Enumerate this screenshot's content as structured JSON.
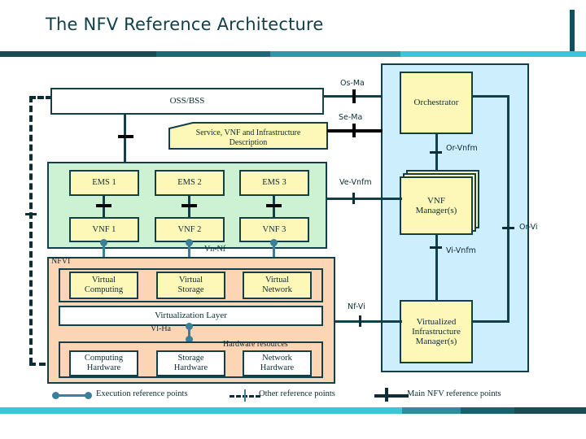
{
  "slide": {
    "title": "The NFV Reference Architecture"
  },
  "theme": {
    "accent_dark": "#14505c",
    "accent_mid": "#1f6676",
    "accent_light": "#2e97a8",
    "accent_bright": "#3bc6d4",
    "box_border": "#123f48",
    "yellow_fill": "#fdf8b8",
    "green_panel": "#ccf2d3",
    "orange_panel": "#fbd5b4",
    "blue_panel": "#cdeefc",
    "exec_point": "#3c7f99"
  },
  "oss": {
    "label": "OSS/BSS"
  },
  "description_note": {
    "line1": "Service, VNF and Infrastructure",
    "line2": "Description"
  },
  "vnf_domain": {
    "ems": [
      "EMS 1",
      "EMS 2",
      "EMS 3"
    ],
    "vnf": [
      "VNF 1",
      "VNF 2",
      "VNF 3"
    ]
  },
  "nfvi": {
    "label": "NFVI",
    "virtual_resources": [
      {
        "line1": "Virtual",
        "line2": "Computing"
      },
      {
        "line1": "Virtual",
        "line2": "Storage"
      },
      {
        "line1": "Virtual",
        "line2": "Network"
      }
    ],
    "virtualization_layer": "Virtualization Layer",
    "hardware_group_label": "Hardware resources",
    "hardware": [
      {
        "line1": "Computing",
        "line2": "Hardware"
      },
      {
        "line1": "Storage",
        "line2": "Hardware"
      },
      {
        "line1": "Network",
        "line2": "Hardware"
      }
    ]
  },
  "mano": {
    "orchestrator": "Orchestrator",
    "vnf_manager": {
      "line1": "VNF",
      "line2": "Manager(s)"
    },
    "vim": {
      "line1": "Virtualized",
      "line2": "Infrastructure",
      "line3": "Manager(s)"
    }
  },
  "reference_points": {
    "os_ma": "Os-Ma",
    "se_ma": "Se-Ma",
    "ve_vnfm": "Ve-Vnfm",
    "or_vnfm": "Or-Vnfm",
    "or_vi": "Or-Vi",
    "vi_vnfm": "Vi-Vnfm",
    "nf_vi": "Nf-Vi",
    "vn_nf": "Vn-Nf",
    "vl_ha": "Vl-Ha"
  },
  "legend": {
    "execution": "Execution reference points",
    "other": "Other reference points",
    "main": "Main NFV reference points"
  }
}
